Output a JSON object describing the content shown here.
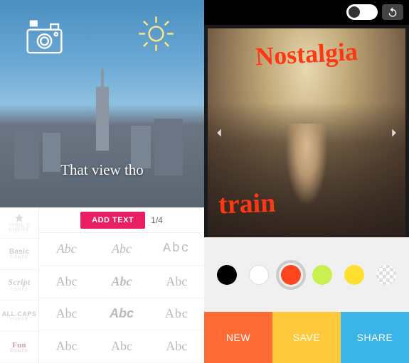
{
  "left": {
    "overlay_text": "That view tho",
    "add_text_label": "ADD TEXT",
    "counter": "1/4",
    "sidebar": [
      {
        "l1": "TYPIC'S",
        "l2": "CHOICE"
      },
      {
        "l1": "Basic",
        "l2": "FONTS"
      },
      {
        "l1": "Script",
        "l2": "FONTS"
      },
      {
        "l1": "ALL CAPS",
        "l2": "FONTS"
      },
      {
        "l1": "Fun",
        "l2": "FONTS"
      }
    ],
    "font_sample": "Abc"
  },
  "right": {
    "handwrite_top": "Nostalgia",
    "handwrite_bottom": "train",
    "colors": [
      "black",
      "white",
      "red",
      "lime",
      "yellow",
      "transparent"
    ],
    "selected_color": "red",
    "actions": {
      "new": "NEW",
      "save": "SAVE",
      "share": "SHARE"
    }
  }
}
